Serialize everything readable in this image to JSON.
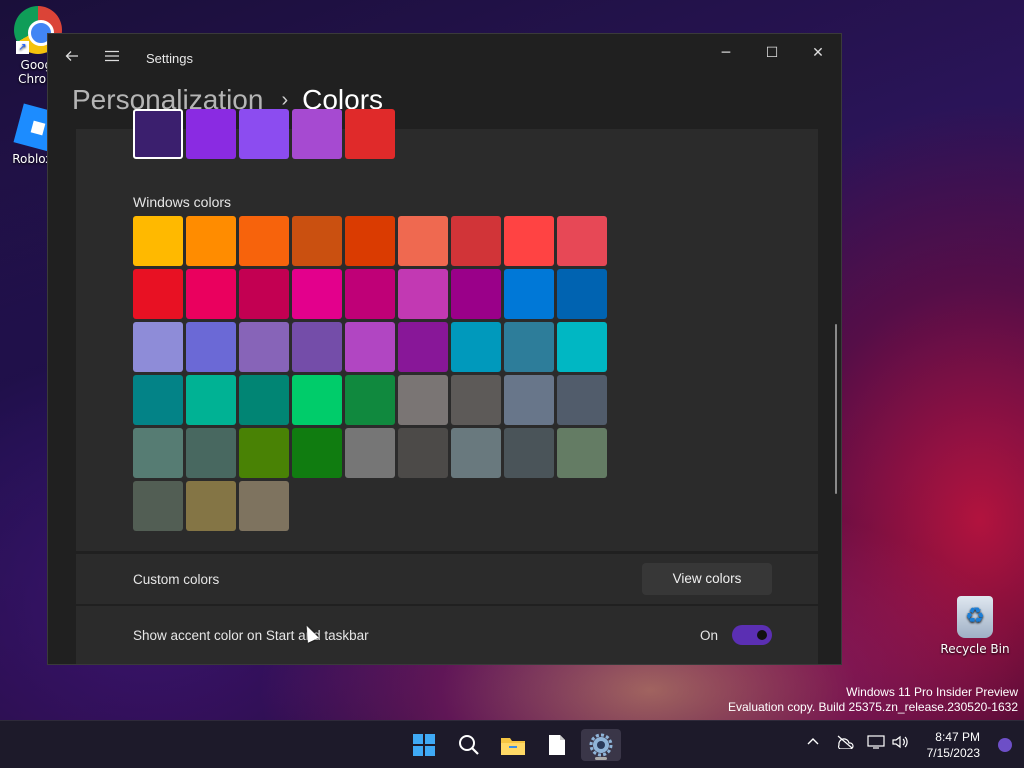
{
  "desktop": {
    "icons": [
      {
        "label": "Googl Chrom",
        "icon": "chrome-icon"
      },
      {
        "label": "Roblox S",
        "icon": "roblox-icon"
      },
      {
        "label": "Recycle Bin",
        "icon": "recycle-bin-icon"
      }
    ],
    "watermark": {
      "line1": "Windows 11 Pro Insider Preview",
      "line2": "Evaluation copy. Build 25375.zn_release.230520-1632"
    }
  },
  "window": {
    "app_title": "Settings",
    "back_icon": "back-arrow-icon",
    "menu_icon": "hamburger-menu-icon",
    "controls": {
      "minimize": "─",
      "maximize": "☐",
      "close": "✕"
    },
    "breadcrumb": {
      "parent": "Personalization",
      "separator": "›",
      "current": "Colors"
    },
    "recent_colors": [
      "#3b1f6e",
      "#8a2be2",
      "#8c4cf0",
      "#a64ad1",
      "#e02a2a"
    ],
    "windows_colors": {
      "label": "Windows colors",
      "rows": [
        [
          "#ffb900",
          "#ff8c00",
          "#f7630c",
          "#ca5010",
          "#da3b01",
          "#ef6950",
          "#d13438",
          "#ff4343",
          "#e74856"
        ],
        [
          "#e81123",
          "#ea005e",
          "#c30052",
          "#e3008c",
          "#bf0077",
          "#c239b3",
          "#9a0089",
          "#0078d7",
          "#0063b1"
        ],
        [
          "#8e8cd8",
          "#6b69d6",
          "#8764b8",
          "#744da9",
          "#b146c2",
          "#881798",
          "#0099bc",
          "#2d7d9a",
          "#00b7c3"
        ],
        [
          "#038387",
          "#00b294",
          "#018574",
          "#00cc6a",
          "#10893e",
          "#7a7574",
          "#5d5a58",
          "#68768a",
          "#515c6b"
        ],
        [
          "#567c73",
          "#486860",
          "#498205",
          "#107c10",
          "#767676",
          "#4c4a48",
          "#69797e",
          "#4a5459",
          "#647c64"
        ],
        [
          "#525e54",
          "#847545",
          "#7e735f"
        ]
      ]
    },
    "custom_colors": {
      "label": "Custom colors",
      "button": "View colors"
    },
    "accent_taskbar": {
      "label": "Show accent color on Start and taskbar",
      "state": "On",
      "toggle_color": "#5b2fb3"
    }
  },
  "taskbar": {
    "icons": [
      "windows-start-icon",
      "search-icon",
      "file-explorer-icon",
      "notepad-icon",
      "settings-icon"
    ],
    "tray": [
      "chevron-up-icon",
      "network-off-icon",
      "display-icon",
      "volume-icon"
    ],
    "time": "8:47 PM",
    "date": "7/15/2023"
  }
}
